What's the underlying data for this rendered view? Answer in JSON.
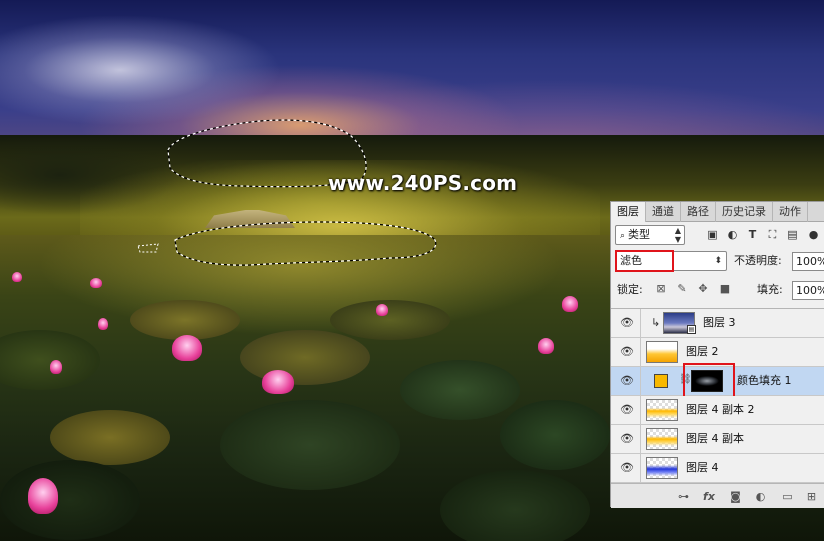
{
  "watermark": "www.240PS.com",
  "colors": {
    "accent_red": "#e0141b",
    "selected_row": "#c1d7f2",
    "fill_swatch": "#f8b800"
  },
  "layers_panel": {
    "tabs": [
      {
        "label": "图层",
        "active": true
      },
      {
        "label": "通道",
        "active": false
      },
      {
        "label": "路径",
        "active": false
      },
      {
        "label": "历史记录",
        "active": false
      },
      {
        "label": "动作",
        "active": false
      }
    ],
    "filter_kind": "类型",
    "filter_icons": [
      "image-filter-icon",
      "adjustment-filter-icon",
      "type-filter-icon",
      "shape-filter-icon",
      "smart-object-filter-icon"
    ],
    "blend_mode": "滤色",
    "opacity_label": "不透明度:",
    "opacity_value": "100%",
    "lock_label": "锁定:",
    "fill_label": "填充:",
    "fill_value": "100%",
    "layers": [
      {
        "name": "图层 3",
        "thumb": "smart-object",
        "clipped": true,
        "selected": false
      },
      {
        "name": "图层 2",
        "thumb": "orange-gradient",
        "clipped": false,
        "selected": false
      },
      {
        "name": "颜色填充 1",
        "thumb": "mask",
        "clipped": false,
        "selected": true
      },
      {
        "name": "图层 4 副本 2",
        "thumb": "orange-transparent",
        "clipped": false,
        "selected": false
      },
      {
        "name": "图层 4 副本",
        "thumb": "orange-transparent",
        "clipped": false,
        "selected": false
      },
      {
        "name": "图层 4",
        "thumb": "blue-gradient",
        "clipped": false,
        "selected": false
      }
    ],
    "bottom_icons": [
      "link-icon",
      "fx-icon",
      "add-mask-icon",
      "adjustment-layer-icon",
      "new-group-icon",
      "new-layer-icon"
    ],
    "fx_label": "fx"
  }
}
